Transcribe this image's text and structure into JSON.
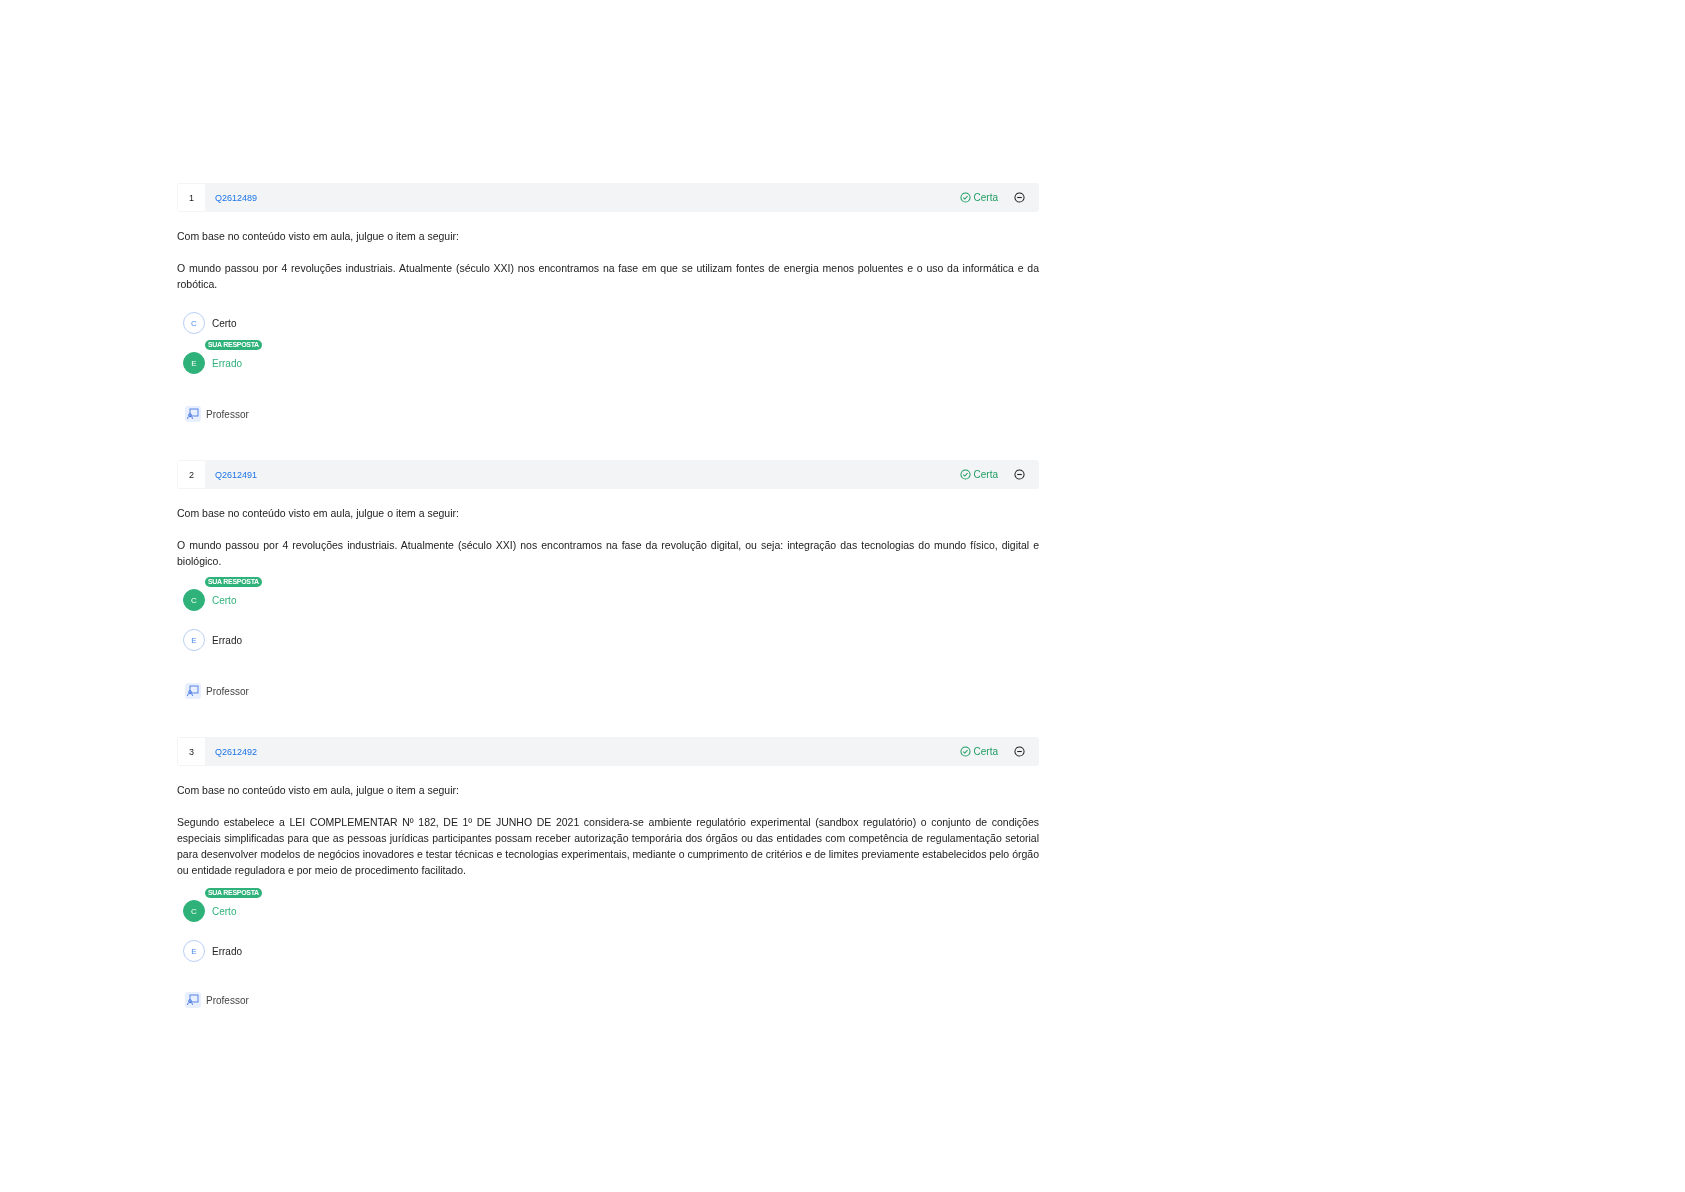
{
  "questions": [
    {
      "number": "1",
      "code": "Q2612489",
      "result": "Certa",
      "prompt": "Com base no conteúdo visto em aula, julgue o item a seguir:",
      "statement": "O mundo passou por 4 revoluções industriais. Atualmente (século XXI) nos encontramos na fase em que se utilizam fontes de energia menos poluentes e o uso da informática e da robótica.",
      "answer_badge": "SUA RESPOSTA",
      "options": [
        {
          "letter": "C",
          "label": "Certo",
          "selected": false
        },
        {
          "letter": "E",
          "label": "Errado",
          "selected": true
        }
      ],
      "teacher_button": "Professor"
    },
    {
      "number": "2",
      "code": "Q2612491",
      "result": "Certa",
      "prompt": "Com base no conteúdo visto em aula, julgue o item a seguir:",
      "statement": "O mundo passou por 4 revoluções industriais. Atualmente (século XXI) nos encontramos na fase da revolução digital, ou seja: integração das tecnologias do mundo físico, digital e biológico.",
      "answer_badge": "SUA RESPOSTA",
      "options": [
        {
          "letter": "C",
          "label": "Certo",
          "selected": true
        },
        {
          "letter": "E",
          "label": "Errado",
          "selected": false
        }
      ],
      "teacher_button": "Professor"
    },
    {
      "number": "3",
      "code": "Q2612492",
      "result": "Certa",
      "prompt": "Com base no conteúdo visto em aula, julgue o item a seguir:",
      "statement": "Segundo estabelece a LEI COMPLEMENTAR Nº 182, DE 1º DE JUNHO DE 2021 considera-se ambiente regulatório experimental (sandbox regulatório) o conjunto de condições especiais simplificadas para que as pessoas jurídicas participantes possam receber autorização temporária dos órgãos ou das entidades com competência de regulamentação setorial para desenvolver modelos de negócios inovadores e testar técnicas e tecnologias experimentais, mediante o cumprimento de critérios e de limites previamente estabelecidos pelo órgão ou entidade reguladora e por meio de procedimento facilitado.",
      "answer_badge": "SUA RESPOSTA",
      "options": [
        {
          "letter": "C",
          "label": "Certo",
          "selected": true
        },
        {
          "letter": "E",
          "label": "Errado",
          "selected": false
        }
      ],
      "teacher_button": "Professor"
    }
  ]
}
